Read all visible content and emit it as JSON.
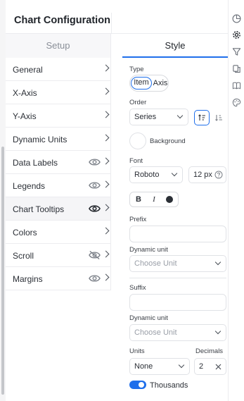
{
  "header": {
    "title": "Chart Configuration"
  },
  "tabs": {
    "setup": "Setup",
    "style": "Style"
  },
  "menu": {
    "items": [
      {
        "label": "General"
      },
      {
        "label": "X-Axis"
      },
      {
        "label": "Y-Axis"
      },
      {
        "label": "Dynamic Units"
      },
      {
        "label": "Data Labels"
      },
      {
        "label": "Legends"
      },
      {
        "label": "Chart Tooltips"
      },
      {
        "label": "Colors"
      },
      {
        "label": "Scroll"
      },
      {
        "label": "Margins"
      }
    ]
  },
  "style": {
    "type_label": "Type",
    "type_item": "Item",
    "type_axis": "Axis",
    "order_label": "Order",
    "order_value": "Series",
    "background_label": "Background",
    "font_label": "Font",
    "font_family": "Roboto",
    "font_size": "12 px",
    "bold": "B",
    "italic": "I",
    "prefix_label": "Prefix",
    "prefix_value": "",
    "prefix_unit_label": "Dynamic unit",
    "prefix_unit_placeholder": "Choose Unit",
    "suffix_label": "Suffix",
    "suffix_value": "",
    "suffix_unit_label": "Dynamic unit",
    "suffix_unit_placeholder": "Choose Unit",
    "units_label": "Units",
    "units_value": "None",
    "decimals_label": "Decimals",
    "decimals_value": "2",
    "thousands_label": "Thousands"
  },
  "colors": {
    "accent": "#1f6feb",
    "text": "#2b2f36",
    "muted": "#8a8f98",
    "border": "#e0e2e6"
  }
}
